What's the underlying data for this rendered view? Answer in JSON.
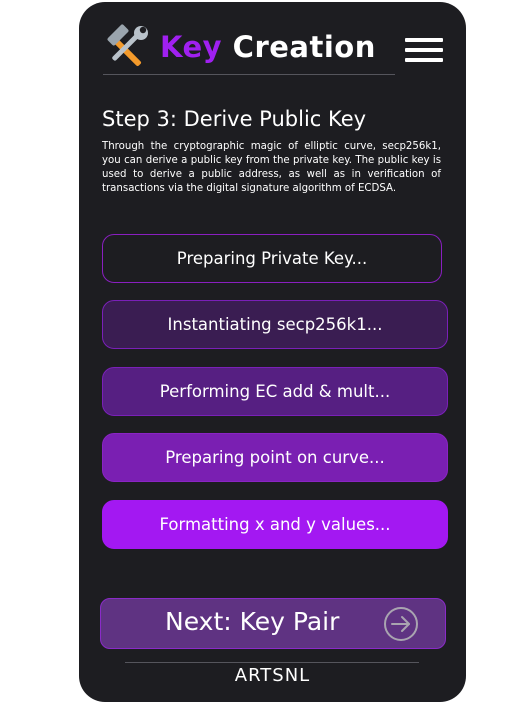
{
  "header": {
    "title_key": "Key",
    "title_rest": "Creation",
    "logo_icon": "tools-icon",
    "menu_icon": "hamburger-menu-icon"
  },
  "step": {
    "title": "Step 3: Derive Public Key",
    "description": "Through the cryptographic magic of elliptic curve, secp256k1, you can derive a public key from the private key. The public key is used to derive a public address, as well as in verification of transactions via the digital signature algorithm of ECDSA."
  },
  "progress_steps": [
    {
      "label": "Preparing Private Key..."
    },
    {
      "label": "Instantiating secp256k1..."
    },
    {
      "label": "Performing EC add & mult..."
    },
    {
      "label": "Preparing point on curve..."
    },
    {
      "label": "Formatting x and y values..."
    }
  ],
  "next_button": {
    "label": "Next: Key Pair",
    "icon": "arrow-right-circle-icon"
  },
  "footer": {
    "brand": "ARTSNL"
  },
  "colors": {
    "background": "#1d1d21",
    "accent": "#a318f2",
    "title_accent": "#a020f0"
  }
}
